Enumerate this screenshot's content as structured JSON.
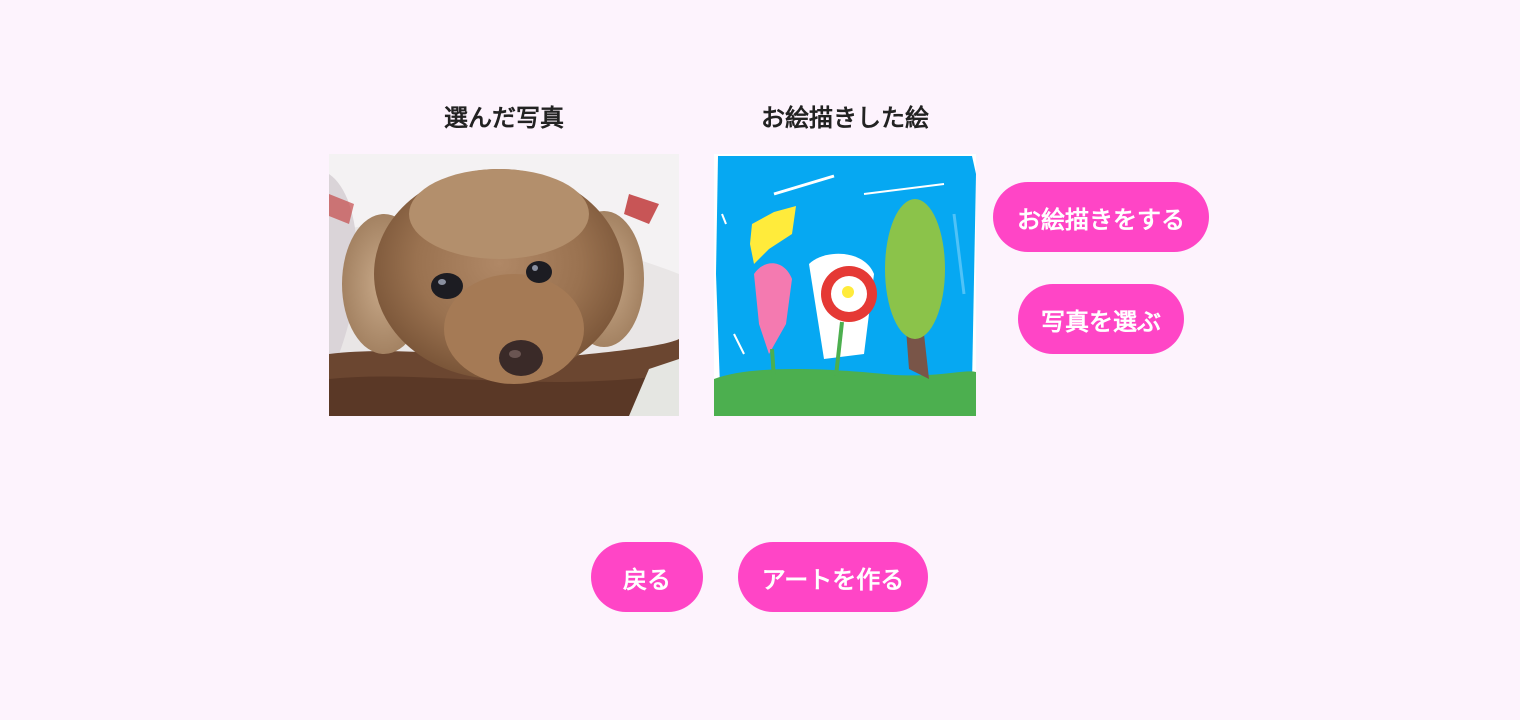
{
  "photo_section": {
    "title": "選んだ写真"
  },
  "drawing_section": {
    "title": "お絵描きした絵"
  },
  "side_buttons": {
    "draw_label": "お絵描きをする",
    "choose_photo_label": "写真を選ぶ"
  },
  "footer_buttons": {
    "back_label": "戻る",
    "create_art_label": "アートを作る"
  },
  "colors": {
    "background": "#fdf3fd",
    "button": "#ff45c6",
    "button_text": "#ffffff",
    "title_text": "#222222"
  }
}
